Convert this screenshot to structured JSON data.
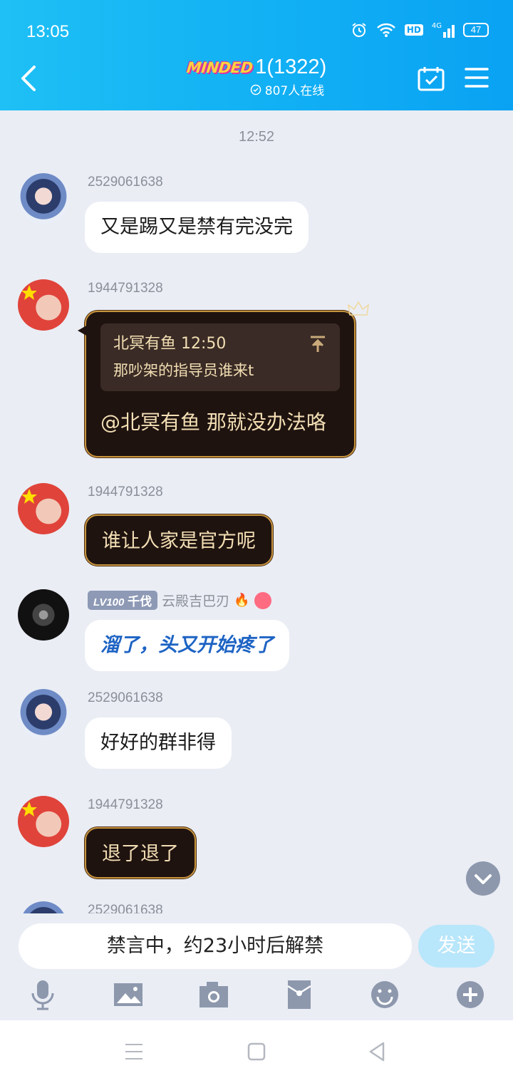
{
  "status": {
    "time": "13:05",
    "battery": "47",
    "network": "4G",
    "hd": "HD"
  },
  "header": {
    "logo_text": "MINDED",
    "group_name": "1(1322)",
    "online": "807人在线"
  },
  "chat": {
    "timestamp": "12:52",
    "messages": [
      {
        "sender": "2529061638",
        "text": "又是踢又是禁有完没完"
      },
      {
        "sender": "1944791328",
        "quote_author": "北冥有鱼",
        "quote_time": "12:50",
        "quote_text": "那吵架的指导员谁来t",
        "text": "@北冥有鱼 那就没办法咯"
      },
      {
        "sender": "1944791328",
        "text": "谁让人家是官方呢"
      },
      {
        "level": "LV100",
        "title": "千伐",
        "sender": "云殿吉巴刃",
        "text": "溜了，头又开始疼了"
      },
      {
        "sender": "2529061638",
        "text": "好好的群非得"
      },
      {
        "sender": "1944791328",
        "text": "退了退了"
      },
      {
        "sender": "2529061638"
      }
    ]
  },
  "input": {
    "muted_text": "禁言中，约23小时后解禁",
    "send_label": "发送"
  },
  "colors": {
    "header_start": "#1ec0f5",
    "header_end": "#0aa2f3",
    "chat_bg": "#eaedf4",
    "vip_bubble": "#1f1310",
    "blue_text": "#1d63c4"
  },
  "icons": [
    "back-icon",
    "checkin-icon",
    "menu-icon",
    "mic-icon",
    "image-icon",
    "camera-icon",
    "red-packet-icon",
    "emoji-icon",
    "plus-icon",
    "chevron-down-icon"
  ]
}
